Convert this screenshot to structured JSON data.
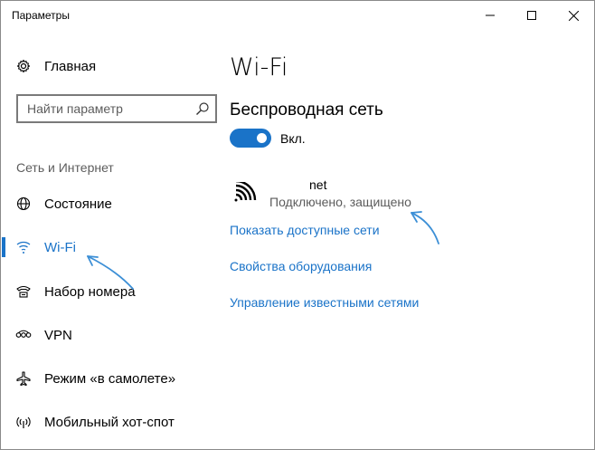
{
  "window": {
    "title": "Параметры",
    "controls": {
      "minimize_icon": "minimize-icon",
      "maximize_icon": "maximize-icon",
      "close_icon": "close-icon"
    }
  },
  "sidebar": {
    "home_label": "Главная",
    "search": {
      "placeholder": "Найти параметр",
      "value": ""
    },
    "section_header": "Сеть и Интернет",
    "items": [
      {
        "label": "Состояние",
        "icon": "globe-icon"
      },
      {
        "label": "Wi-Fi",
        "icon": "wifi-icon",
        "active": true
      },
      {
        "label": "Набор номера",
        "icon": "dialup-icon"
      },
      {
        "label": "VPN",
        "icon": "vpn-icon"
      },
      {
        "label": "Режим «в самолете»",
        "icon": "airplane-icon"
      },
      {
        "label": "Мобильный хот-спот",
        "icon": "hotspot-icon"
      }
    ]
  },
  "main": {
    "title": "Wi-Fi",
    "wireless_header": "Беспроводная сеть",
    "toggle": {
      "state": "on",
      "label": "Вкл."
    },
    "network": {
      "name": "net",
      "status": "Подключено, защищено"
    },
    "links": {
      "show_available": "Показать доступные сети",
      "hardware_properties": "Свойства оборудования",
      "manage_known": "Управление известными сетями"
    }
  },
  "colors": {
    "accent": "#1a73c8",
    "annotation_arrow": "#3c8fd6",
    "secondary_text": "#5c5c5c"
  }
}
